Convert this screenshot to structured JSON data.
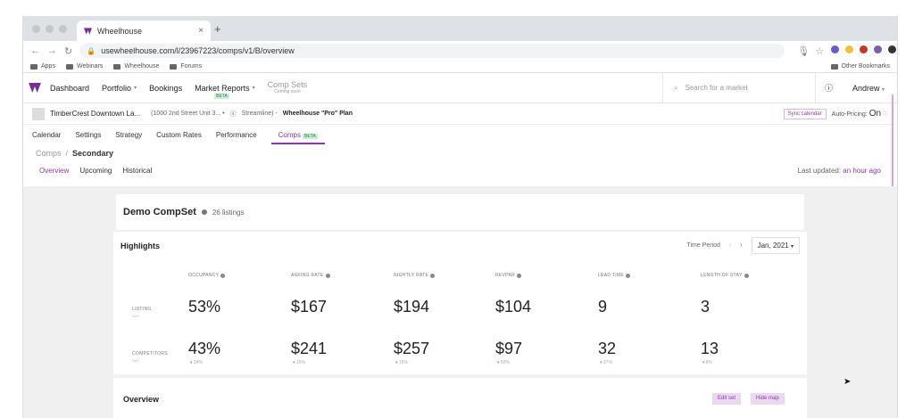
{
  "browser": {
    "tab_title": "Wheelhouse",
    "url": "usewheelhouse.com/l/23967223/comps/v1/B/overview",
    "bookmarks": [
      "Apps",
      "Webinars",
      "Wheelhouse",
      "Forums"
    ],
    "other_bookmarks": "Other Bookmarks"
  },
  "nav": {
    "items": [
      "Dashboard",
      "Portfolio",
      "Bookings",
      "Market Reports"
    ],
    "beta": "BETA",
    "comp_sets": "Comp Sets",
    "coming_soon": "Coming soon",
    "search_placeholder": "Search for a market",
    "user": "Andrew"
  },
  "property": {
    "name": "TimberCrest Downtown La...",
    "address": "(1000 2nd Street Unit 3... •",
    "pms": "Streamline) -",
    "plan": "Wheelhouse \"Pro\" Plan",
    "sync_label": "Sync calendar",
    "auto_pricing_label": "Auto-Pricing:",
    "auto_pricing_value": "On"
  },
  "subtabs": [
    "Calendar",
    "Settings",
    "Strategy",
    "Custom Rates",
    "Performance",
    "Comps"
  ],
  "comps_beta": "BETA",
  "breadcrumb": {
    "root": "Comps",
    "sep": "/",
    "current": "Secondary"
  },
  "view_tabs": [
    "Overview",
    "Upcoming",
    "Historical"
  ],
  "last_updated": {
    "label": "Last updated:",
    "value": "an hour ago"
  },
  "compset": {
    "title": "Demo CompSet",
    "listings": "26 listings"
  },
  "highlights": {
    "title": "Highlights",
    "period_label": "Time Period",
    "period_value": "Jan, 2021",
    "columns": [
      "OCCUPANCY",
      "ASKING RATE",
      "NIGHTLY RATE",
      "REVPAR",
      "LEAD TIME",
      "LENGTH OF STAY"
    ],
    "rows": [
      {
        "label": "LISTING",
        "sub": "YoY",
        "values": [
          "53%",
          "$167",
          "$194",
          "$104",
          "9",
          "3"
        ]
      },
      {
        "label": "COMPETITORS",
        "sub": "YoY",
        "values": [
          "43%",
          "$241",
          "$257",
          "$97",
          "32",
          "13"
        ],
        "deltas": [
          "34%",
          "15%",
          "16%",
          "50%",
          "37%",
          "8%"
        ]
      }
    ]
  },
  "overview": {
    "title": "Overview",
    "edit_set": "Edit set",
    "hide_map": "Hide map"
  }
}
